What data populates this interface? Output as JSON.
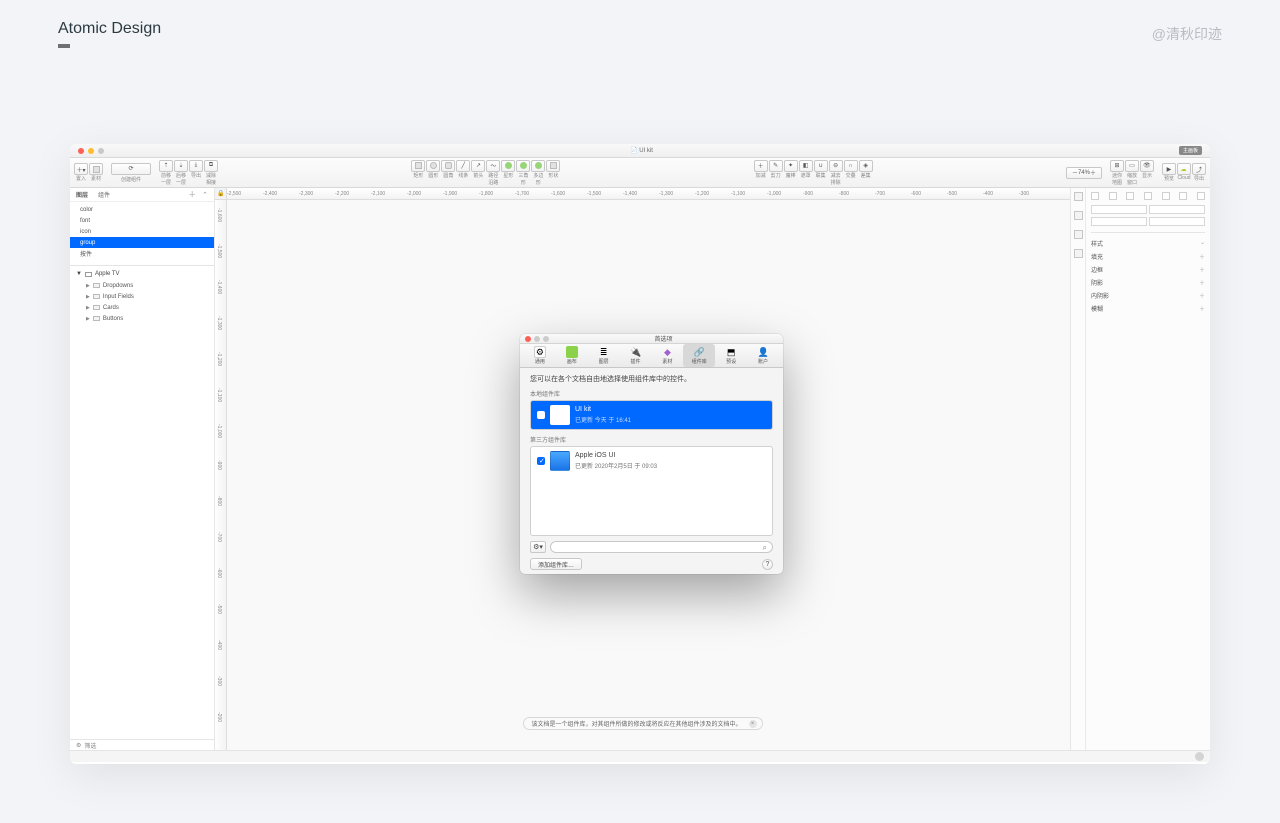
{
  "page": {
    "title": "Atomic Design",
    "author": "@清秋印迹"
  },
  "window": {
    "title": "📄 UI kit",
    "toolbar_right_btn": "主画板"
  },
  "zoom": "74%",
  "toolbar": {
    "insert": "置入",
    "material": "素材",
    "group_create_label": "创建组件",
    "forward": "前移一层",
    "backward": "后移一层",
    "export": "导出",
    "merge_path": "减除相接",
    "shapes": {
      "rect": "矩形",
      "oval": "圆形",
      "rounded": "圆角",
      "line": "线条",
      "arrow": "箭头",
      "text_path": "路径沿路",
      "star": "星形",
      "triangle": "三角形",
      "polygon": "多边形",
      "shape": "形状"
    },
    "ops": {
      "plus": "加减",
      "pen": "剪刀",
      "magic": "魔棒",
      "graph": "遮罩",
      "brush": "联集",
      "scissors": "减去排除",
      "comp": "交叠",
      "mask": "差集"
    },
    "view": {
      "zoom": "迷你地图",
      "window": "缩放窗口",
      "show": "显示"
    },
    "right": {
      "preview": "预览",
      "cloud": "Cloud",
      "export2": "导出"
    }
  },
  "left_panel": {
    "tabs": {
      "pages": "图层",
      "components": "组件"
    },
    "layers": [
      "color",
      "font",
      "icon",
      "group",
      "按件"
    ],
    "selected_index": 3,
    "section_title": "Apple TV",
    "components": [
      "Dropdowns",
      "Input Fields",
      "Cards",
      "Buttons"
    ],
    "filter": "筛选"
  },
  "ruler_marks": [
    "-2,500",
    "-2,400",
    "-2,300",
    "-2,200",
    "-2,100",
    "-2,000",
    "-1,900",
    "-1,800",
    "-1,700",
    "-1,600",
    "-1,500",
    "-1,400",
    "-1,300",
    "-1,200",
    "-1,100",
    "-1,000",
    "-900",
    "-800",
    "-700",
    "-600",
    "-500",
    "-400",
    "-300"
  ],
  "ruler_v_marks": [
    "-1,600",
    "-1,500",
    "-1,400",
    "-1,300",
    "-1,200",
    "-1,100",
    "-1,000",
    "-900",
    "-800",
    "-700",
    "-600",
    "-500",
    "-400",
    "-300",
    "-200"
  ],
  "right_panel": {
    "style": "样式",
    "sections": [
      "填充",
      "边框",
      "阴影",
      "内阴影",
      "模糊"
    ]
  },
  "toast": "该文档是一个组件库，对其组件所做的修改或将反应在其他组件涉及的文档中。",
  "prefs": {
    "title": "首选项",
    "tabs": [
      "通用",
      "画布",
      "图层",
      "插件",
      "素材",
      "组件库",
      "预设",
      "账户"
    ],
    "selected_tab": 5,
    "desc": "您可以在各个文档自由地选择使用组件库中的控件。",
    "local_section": "本地组件库",
    "thirdparty_section": "第三方组件库",
    "lib1": {
      "title": "UI kit",
      "sub": "已更新    今天 于 16:41"
    },
    "lib2": {
      "title": "Apple iOS UI",
      "sub": "已更新    2020年2月5日 于 09:03"
    },
    "add_btn": "添加组件库…"
  }
}
